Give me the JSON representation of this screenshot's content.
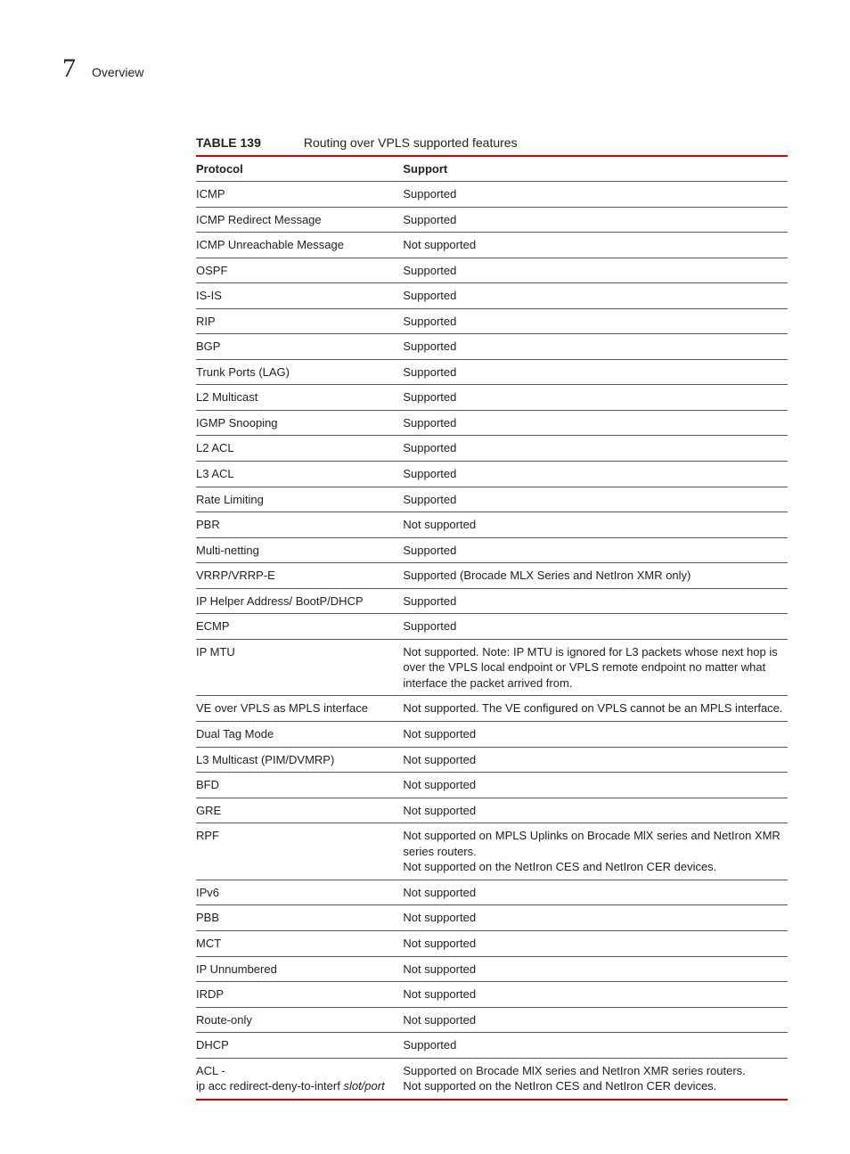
{
  "header": {
    "chapter_number": "7",
    "chapter_text": "Overview"
  },
  "table": {
    "label": "TABLE 139",
    "title": "Routing over VPLS supported features",
    "columns": [
      "Protocol",
      "Support"
    ],
    "rows": [
      {
        "protocol": "ICMP",
        "support": "Supported"
      },
      {
        "protocol": "ICMP Redirect Message",
        "support": "Supported"
      },
      {
        "protocol": "ICMP Unreachable Message",
        "support": "Not supported"
      },
      {
        "protocol": "OSPF",
        "support": "Supported"
      },
      {
        "protocol": "IS-IS",
        "support": "Supported"
      },
      {
        "protocol": "RIP",
        "support": "Supported"
      },
      {
        "protocol": "BGP",
        "support": "Supported"
      },
      {
        "protocol": "Trunk Ports (LAG)",
        "support": "Supported"
      },
      {
        "protocol": "L2 Multicast",
        "support": "Supported"
      },
      {
        "protocol": "IGMP Snooping",
        "support": "Supported"
      },
      {
        "protocol": "L2 ACL",
        "support": "Supported"
      },
      {
        "protocol": "L3 ACL",
        "support": "Supported"
      },
      {
        "protocol": "Rate Limiting",
        "support": "Supported"
      },
      {
        "protocol": "PBR",
        "support": "Not supported"
      },
      {
        "protocol": "Multi-netting",
        "support": "Supported"
      },
      {
        "protocol": "VRRP/VRRP-E",
        "support": "Supported (Brocade MLX Series and NetIron XMR only)"
      },
      {
        "protocol": "IP Helper Address/ BootP/DHCP",
        "support": "Supported"
      },
      {
        "protocol": "ECMP",
        "support": "Supported"
      },
      {
        "protocol": "IP MTU",
        "support": "Not supported. Note: IP MTU is ignored for L3 packets whose next hop is over the VPLS local endpoint or VPLS remote endpoint no matter what interface the packet arrived from."
      },
      {
        "protocol": "VE over VPLS as MPLS interface",
        "support": "Not supported. The VE configured on VPLS cannot be an MPLS interface."
      },
      {
        "protocol": "Dual Tag Mode",
        "support": "Not supported"
      },
      {
        "protocol": "L3 Multicast (PIM/DVMRP)",
        "support": "Not supported"
      },
      {
        "protocol": "BFD",
        "support": "Not supported"
      },
      {
        "protocol": "GRE",
        "support": "Not supported"
      },
      {
        "protocol": "RPF",
        "support": "Not supported on MPLS Uplinks on Brocade MlX series and NetIron XMR series routers.\nNot supported on the NetIron CES and NetIron CER devices."
      },
      {
        "protocol": "IPv6",
        "support": "Not supported"
      },
      {
        "protocol": "PBB",
        "support": "Not supported"
      },
      {
        "protocol": "MCT",
        "support": "Not supported"
      },
      {
        "protocol": "IP Unnumbered",
        "support": "Not supported"
      },
      {
        "protocol": "IRDP",
        "support": "Not supported"
      },
      {
        "protocol": "Route-only",
        "support": "Not supported"
      },
      {
        "protocol": "DHCP",
        "support": "Supported"
      },
      {
        "protocol_html": "ACL -<br>ip acc redirect-deny-to-interf <span class=\"italic\">slot/port</span>",
        "support": "Supported on Brocade MlX series and NetIron XMR series routers.\nNot supported on the NetIron CES and NetIron CER devices."
      }
    ]
  }
}
